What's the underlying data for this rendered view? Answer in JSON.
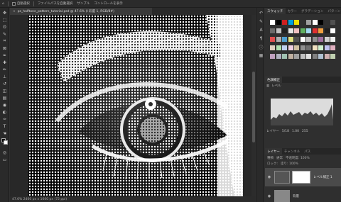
{
  "topbar": {
    "home_icon": "home-icon",
    "tool_label": "自動選択",
    "option_1": "ファイルパスを自動選択",
    "option_2": "サンプル",
    "items": [
      "コントロールを表示",
      "すべてを表示"
    ]
  },
  "document": {
    "tab_title": "ps_halftone_pattern_tutorial.psd @ 47.6% (I 彩度 1, RGB/8#)",
    "status_text": "47.6%    2400 px x 1600 px (72 ppi)"
  },
  "swatches": {
    "tabs": [
      "スウォッチ",
      "カラー",
      "グラデーション",
      "パターン"
    ],
    "colors": [
      "#ffffff",
      "#000000",
      "#cf2020",
      "#00a0e0",
      "#f0e000",
      "#303030",
      "#a0a0a0",
      "#ffffff",
      "#000000",
      "#303030",
      "#505050",
      "#6a6a6a",
      "#c0c0c0",
      "#202020",
      "#e8e8e8",
      "#f0c0c0",
      "#60b060",
      "#a0d8f0",
      "#e03030",
      "#f0a040",
      "#202020",
      "#ffffff",
      "#e05050",
      "#b0b0b0",
      "#50a0d0",
      "#e0e080",
      "#505050",
      "#ffffff",
      "#c0c0c0",
      "#909090",
      "#a070a0",
      "#d0d0d0",
      "#f0f0f0",
      "#e0d0c0",
      "#b0e0b0",
      "#c0d0f0",
      "#f0d0e0",
      "#d0c0a0",
      "#909090",
      "#707070",
      "#f0e0c0",
      "#d0f0d0",
      "#c0c0f0",
      "#e0b0c0",
      "#c0a0c0",
      "#b0b0c0",
      "#a0c0b0",
      "#c0b0a0",
      "#a0a0a0",
      "#c0c0c0",
      "#e0e0e0",
      "#808080",
      "#b0c0d0",
      "#d0b0b0",
      "#c0d0b0"
    ]
  },
  "properties": {
    "title": "色調補正",
    "levels_label": "レベル",
    "input_label": "レイヤー",
    "input_values": [
      "5/18",
      "1.00",
      "255"
    ]
  },
  "layers": {
    "tabs": [
      "レイヤー",
      "チャンネル",
      "パス"
    ],
    "controls": [
      "種類",
      "通常",
      "不透明度: 100%",
      "ロック:",
      "塗り: 100%"
    ],
    "items": [
      {
        "name": "レベル補正 1",
        "visible": true
      },
      {
        "name": "背景",
        "visible": true
      }
    ]
  }
}
